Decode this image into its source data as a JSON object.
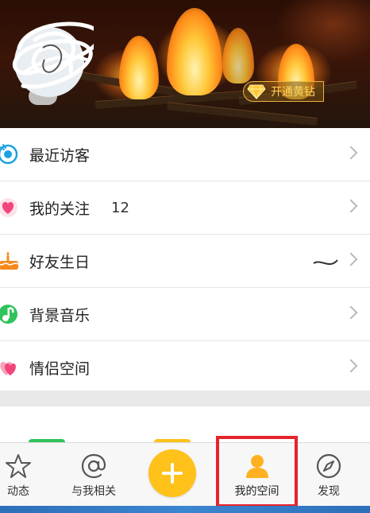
{
  "banner": {
    "vip_label": "开通黄钻"
  },
  "menu": [
    {
      "label": "最近访客",
      "icon": "visitor-eye-icon"
    },
    {
      "label": "我的关注",
      "count": "12",
      "icon": "heart-icon"
    },
    {
      "label": "好友生日",
      "icon": "birthday-cake-icon"
    },
    {
      "label": "背景音乐",
      "icon": "music-note-icon"
    },
    {
      "label": "情侣空间",
      "icon": "couple-hearts-icon"
    }
  ],
  "tabbar": {
    "tabs": [
      {
        "label": "动态",
        "icon": "star-icon"
      },
      {
        "label": "与我相关",
        "icon": "at-icon"
      },
      {
        "label": "",
        "icon": "plus-icon"
      },
      {
        "label": "我的空间",
        "icon": "person-icon"
      },
      {
        "label": "发现",
        "icon": "compass-icon"
      }
    ]
  },
  "colors": {
    "accent_yellow": "#ffc21a",
    "highlight_red": "#e5232b",
    "blue_icon": "#1aa3e0",
    "pink_icon": "#f2467b",
    "orange_icon": "#f58a1f",
    "green_icon": "#2fc35a"
  }
}
